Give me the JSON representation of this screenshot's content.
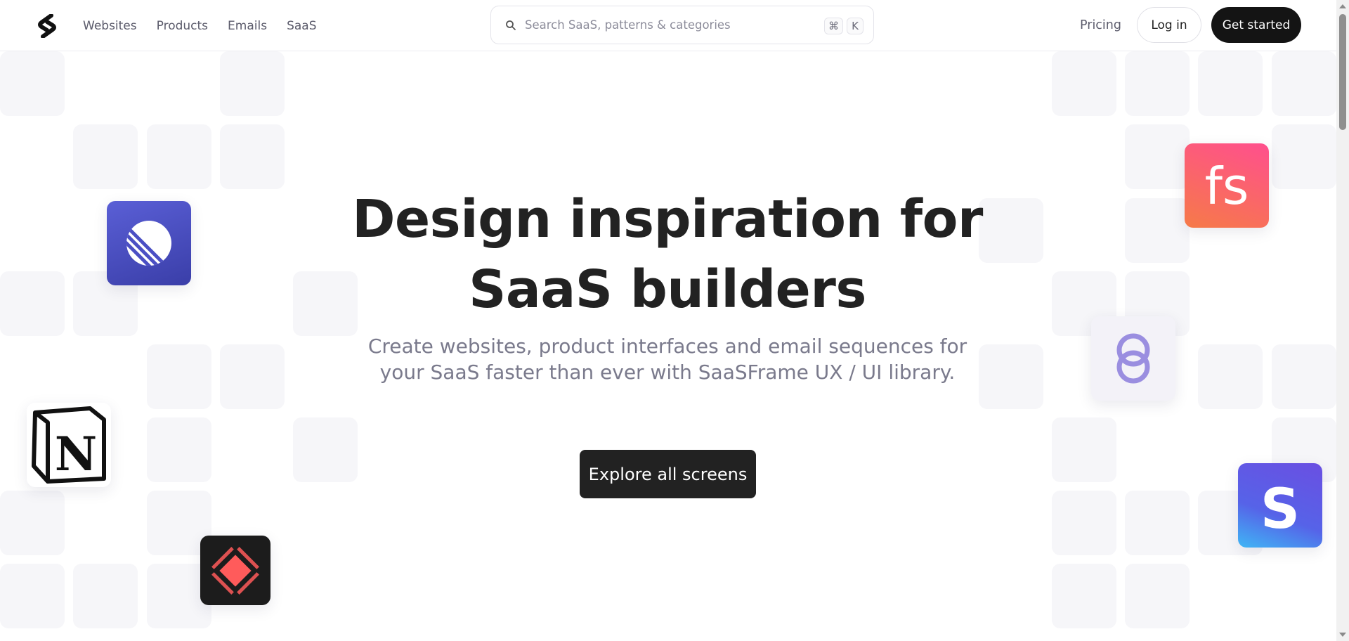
{
  "header": {
    "nav": [
      {
        "label": "Websites"
      },
      {
        "label": "Products"
      },
      {
        "label": "Emails"
      },
      {
        "label": "SaaS"
      }
    ],
    "search": {
      "placeholder": "Search SaaS, patterns & categories",
      "shortcut_cmd": "⌘",
      "shortcut_key": "K"
    },
    "pricing_label": "Pricing",
    "login_label": "Log in",
    "get_started_label": "Get started"
  },
  "hero": {
    "title_line1": "Design inspiration for",
    "title_line2": "SaaS builders",
    "subtitle": "Create websites, product interfaces and email sequences for your SaaS faster than ever with SaaSFrame UX / UI library.",
    "cta_label": "Explore all screens"
  },
  "icons": {
    "linear": "linear-app-icon",
    "notion": "notion-app-icon",
    "notion_letter": "N",
    "raycast": "raycast-app-icon",
    "fs": "fs-app-icon",
    "fs_text": "fs",
    "rings": "rings-app-icon",
    "stripe": "stripe-app-icon",
    "stripe_letter": "S"
  },
  "colors": {
    "primary_dark": "#141414",
    "linear_bg": "#4b4fc4",
    "fs_gradient_start": "#ff5f8a",
    "fs_gradient_end": "#f57a45",
    "stripe_bg": "#5c55e6",
    "raycast_red": "#ff5b5b"
  }
}
